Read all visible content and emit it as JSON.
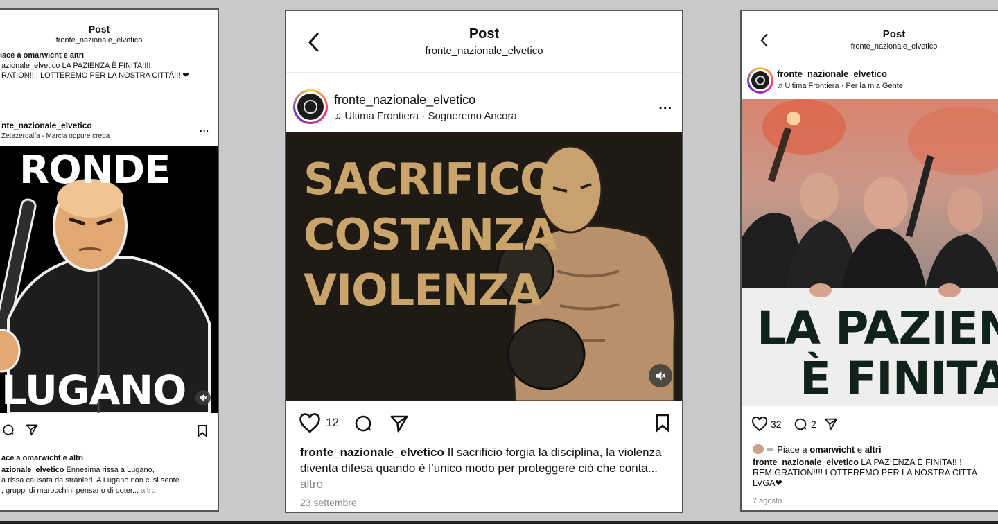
{
  "colors": {
    "page_bg": "#c9c9c9",
    "poster_gold": "#c9a56b",
    "poster_dark": "#1f1a14",
    "banner_text": "#10231a"
  },
  "left_post": {
    "header_title": "Post",
    "header_subtitle": "fronte_nazionale_elvetico",
    "prev_likes": "iace a omarwicht e altri",
    "prev_caption_line1": "azionale_elvetico LA PAZIENZA È FINITA!!!!",
    "prev_caption_line2": "RATION!!!! LOTTEREMO PER LA NOSTRA CITTÀ!!! ❤",
    "username": "nte_nazionale_elvetico",
    "music": "Zetazeroalfa - Marcia oppure crepa",
    "more": "...",
    "poster_top": "RONDE",
    "poster_bottom": "LUGANO",
    "likes": "ace a omarwicht e altri",
    "caption_user": "azionale_elvetico",
    "caption_line1": " Ennesima rissa a Lugano,",
    "caption_line2": "a rissa causata da stranieri. A Lugano non ci si sente",
    "caption_line3": ", gruppi di marocchini pensano di poter...",
    "caption_more": "altro",
    "icons": [
      "comment-icon",
      "share-icon",
      "bookmark-icon",
      "mute-icon"
    ]
  },
  "mid_post": {
    "header_title": "Post",
    "header_subtitle": "fronte_nazionale_elvetico",
    "username": "fronte_nazionale_elvetico",
    "music": "Ultima Frontiera · Sogneremo Ancora",
    "more": "...",
    "poster_lines": [
      "SACRIFICO",
      "COSTANZA",
      "VIOLENZA"
    ],
    "like_count": "12",
    "caption_user": "fronte_nazionale_elvetico",
    "caption_text": " Il sacrificio forgia la disciplina, la violenza diventa difesa quando è l’unico modo per proteggere ciò che conta...",
    "caption_more": "altro",
    "date": "23 settembre",
    "icons": [
      "back-icon",
      "heart-icon",
      "comment-icon",
      "share-icon",
      "bookmark-icon",
      "mute-icon",
      "music-note-icon"
    ]
  },
  "right_post": {
    "header_title": "Post",
    "header_subtitle": "fronte_nazionale_elvetico",
    "username": "fronte_nazionale_elvetico",
    "music": "Ultima Frontiera · Per la mia Gente",
    "banner_line1": "LA PAZIENZA",
    "banner_line2": "È FINITA",
    "like_count": "32",
    "comment_count": "2",
    "likes_prefix": "Piace a ",
    "likes_user": "omarwicht",
    "likes_mid": " e ",
    "likes_rest": "altri",
    "caption_user": "fronte_nazionale_elvetico",
    "caption_line1": " LA PAZIENZA È FINITA!!!!",
    "caption_line2": "REMIGRATION!!!! LOTTEREMO PER LA NOSTRA CITTÀ",
    "caption_line3": "LVGA❤",
    "date": "7 agosto",
    "icons": [
      "back-icon",
      "heart-icon",
      "comment-icon",
      "share-icon",
      "music-note-icon"
    ]
  }
}
